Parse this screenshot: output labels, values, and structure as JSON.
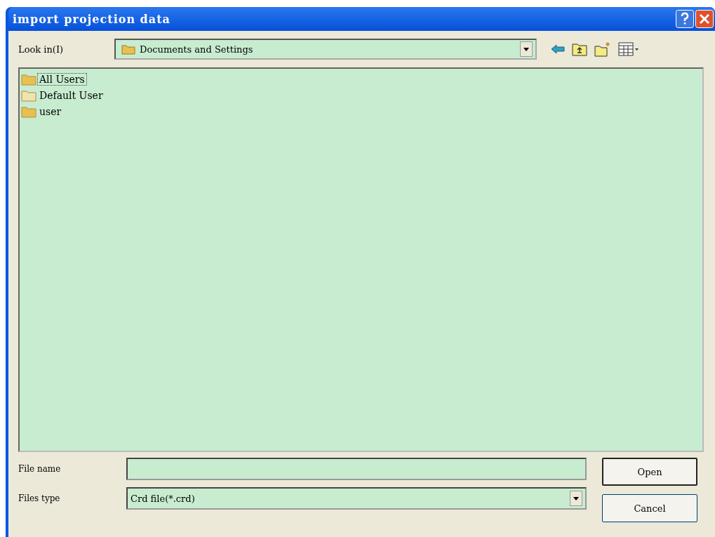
{
  "window": {
    "title": "import projection data"
  },
  "look_in": {
    "label": "Look in(I)",
    "value": "Documents and Settings"
  },
  "files": [
    {
      "name": "All Users",
      "selected": true,
      "kind": "folder"
    },
    {
      "name": "Default User",
      "selected": false,
      "kind": "faded-folder"
    },
    {
      "name": "user",
      "selected": false,
      "kind": "folder"
    }
  ],
  "file_name": {
    "label": "File name"
  },
  "files_type": {
    "label": "Files type",
    "value": "Crd file(*.crd)"
  },
  "buttons": [
    "Open",
    "Cancel"
  ]
}
